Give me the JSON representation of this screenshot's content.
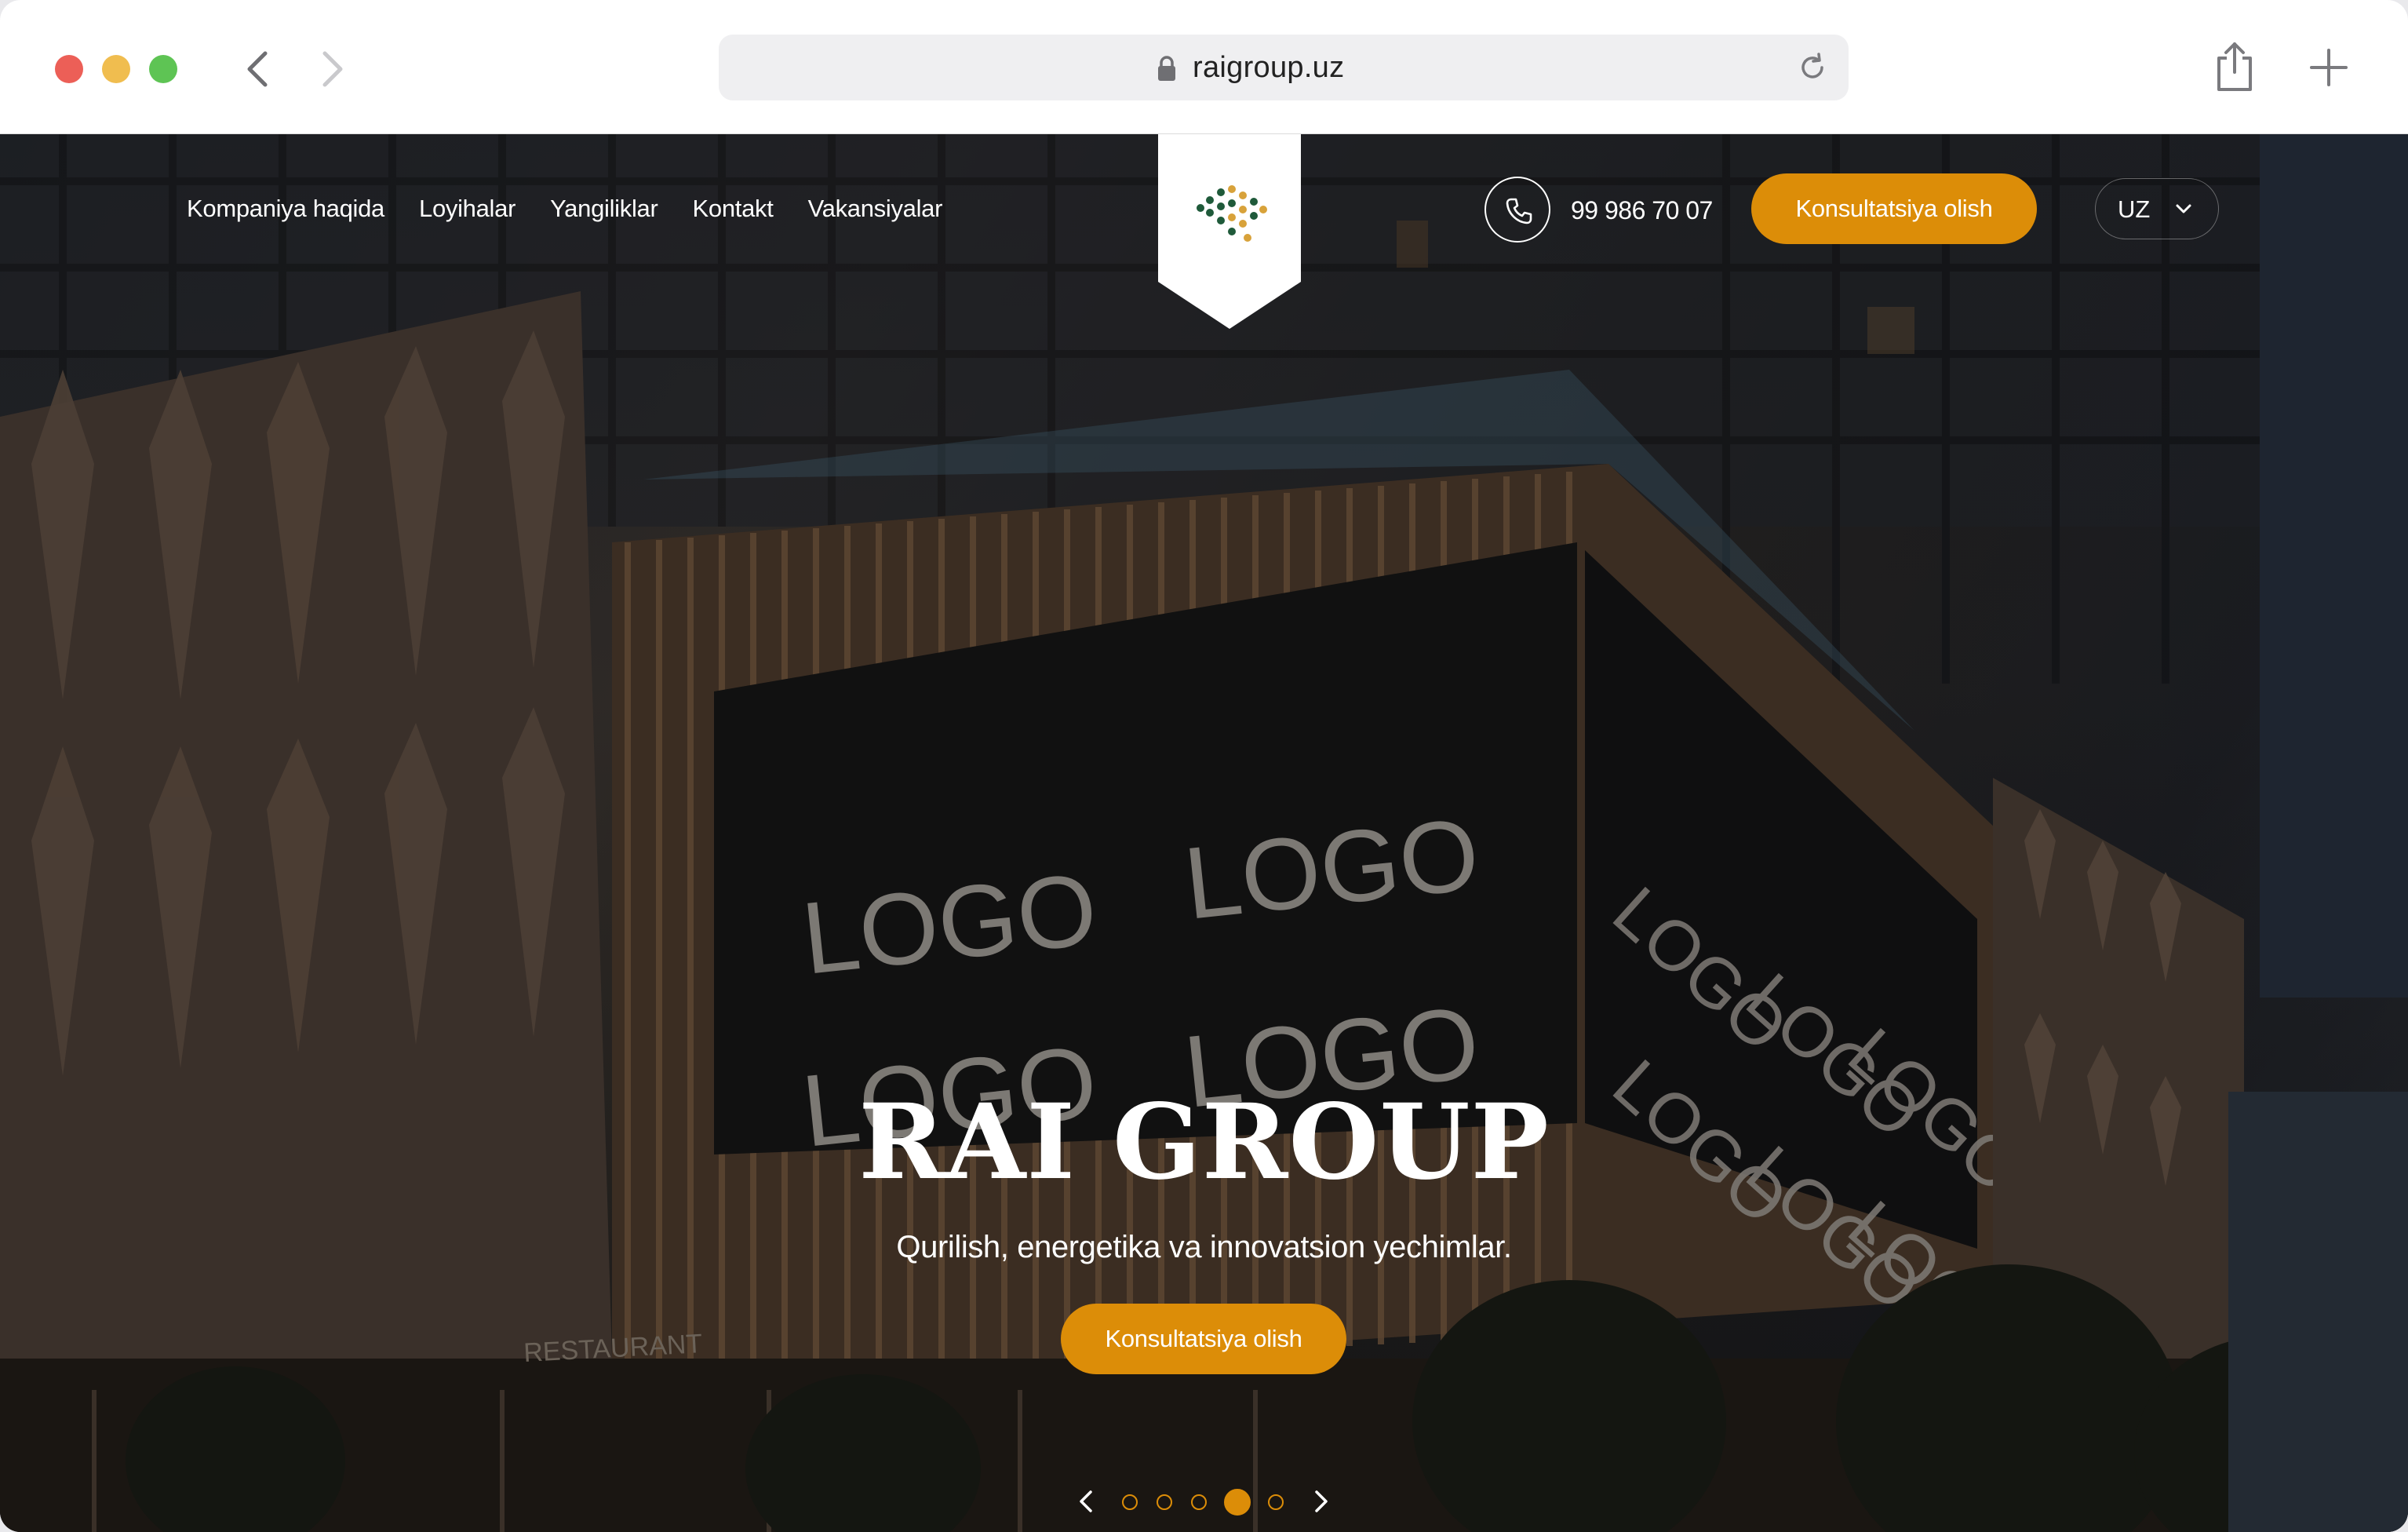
{
  "browser": {
    "url": "raigroup.uz"
  },
  "header": {
    "nav": [
      "Kompaniya haqida",
      "Loyihalar",
      "Yangiliklar",
      "Kontakt",
      "Vakansiyalar"
    ],
    "phone": "99 986 70 07",
    "cta_label": "Konsultatsiya olish",
    "language": "UZ"
  },
  "hero": {
    "title": "RAI GROUP",
    "subtitle": "Qurilish, energetika va innovatsion yechimlar.",
    "cta_label": "Konsultatsiya olish",
    "slides_total": 5,
    "active_slide": 4,
    "signage_text": "LOGO",
    "storefront_text": "RESTAURANT"
  },
  "colors": {
    "accent": "#dc8d08",
    "logo_green": "#1f5a3a",
    "logo_gold": "#d8a23a"
  },
  "icons": [
    "close-icon",
    "minimize-icon",
    "zoom-icon",
    "back-icon",
    "forward-icon",
    "lock-icon",
    "reload-icon",
    "share-icon",
    "new-tab-icon",
    "phone-icon",
    "chevron-down-icon",
    "chevron-left-icon",
    "chevron-right-icon"
  ]
}
